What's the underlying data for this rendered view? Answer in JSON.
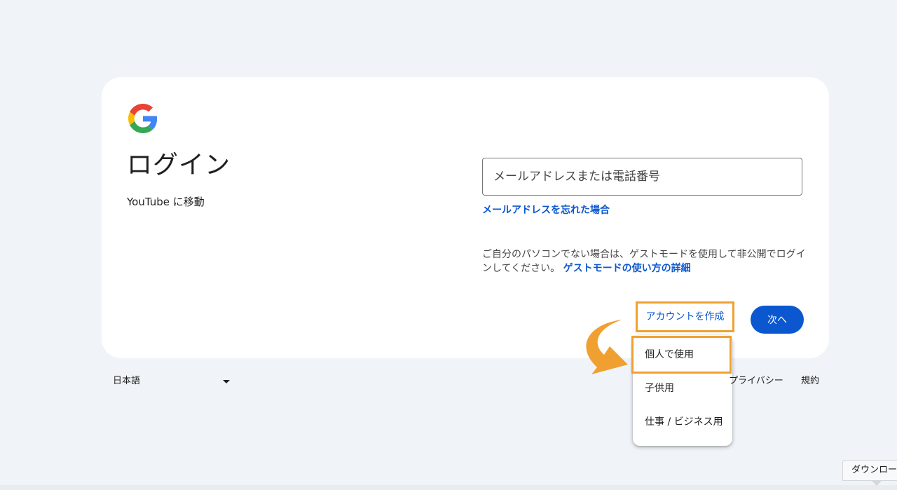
{
  "card": {
    "title": "ログイン",
    "subtitle": "YouTube に移動"
  },
  "email": {
    "placeholder": "メールアドレスまたは電話番号",
    "value": ""
  },
  "forgot_email": "メールアドレスを忘れた場合",
  "guest": {
    "text": "ご自分のパソコンでない場合は、ゲストモードを使用して非公開でログインしてください。",
    "link": "ゲストモードの使い方の詳細"
  },
  "actions": {
    "create_account": "アカウントを作成",
    "next": "次へ"
  },
  "create_menu": {
    "items": [
      {
        "label": "個人で使用"
      },
      {
        "label": "子供用"
      },
      {
        "label": "仕事 / ビジネス用"
      }
    ]
  },
  "footer": {
    "language": "日本語",
    "privacy": "プライバシー",
    "terms": "規約"
  },
  "download_tab": "ダウンロード",
  "colors": {
    "background": "#f0f4f9",
    "primary": "#0b57d0",
    "highlight": "#f0a030"
  },
  "icons": {
    "logo": "google-g-logo",
    "language_caret": "caret-down-icon",
    "annotation": "curved-arrow-icon"
  }
}
